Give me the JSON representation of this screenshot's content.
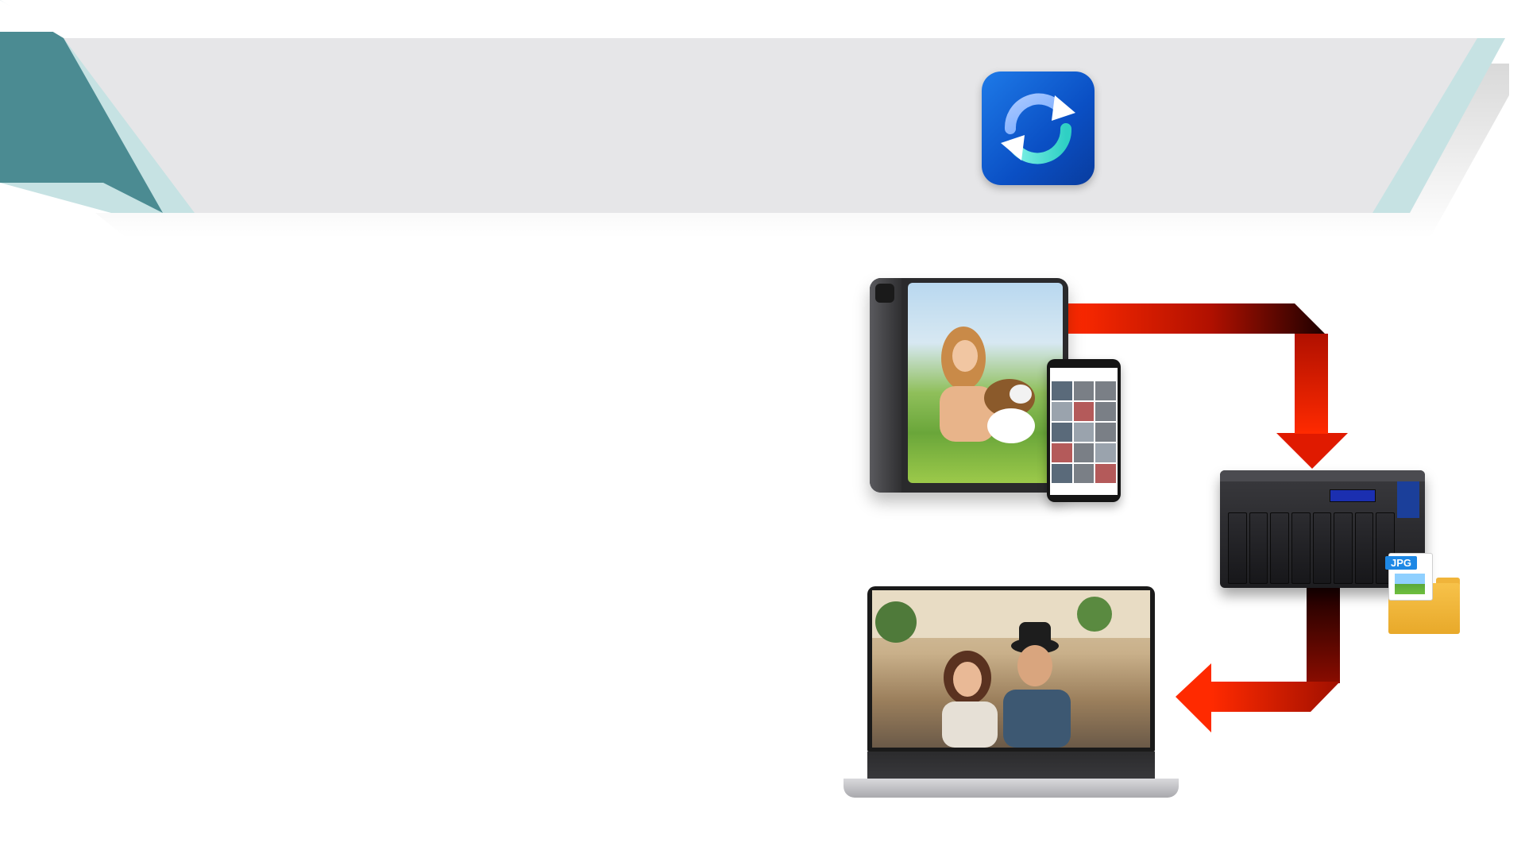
{
  "banner": {
    "background_color": "#e6e6e8",
    "accent_dark": "#4b8b92",
    "accent_light": "#c6e2e3"
  },
  "app_icon": {
    "icon": "sync-arrows-icon",
    "gradient": [
      "#1e7ae8",
      "#093c9e"
    ]
  },
  "diagram": {
    "arrow_colors": [
      "#ff2a00",
      "#1a0000"
    ],
    "devices": [
      {
        "name": "tablet",
        "icon": "tablet-icon"
      },
      {
        "name": "smartphone",
        "icon": "smartphone-icon"
      },
      {
        "name": "nas",
        "icon": "nas-server-icon"
      },
      {
        "name": "laptop",
        "icon": "laptop-icon"
      }
    ],
    "file_badge": "JPG"
  }
}
